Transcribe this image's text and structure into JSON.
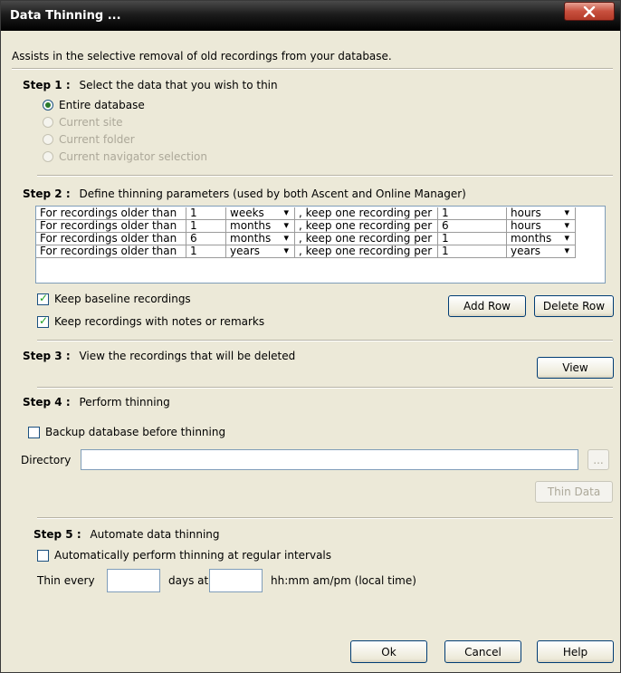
{
  "window": {
    "title": "Data Thinning ..."
  },
  "description": "Assists in the selective removal of old recordings from your database.",
  "step1": {
    "label": "Step 1 :",
    "text": "Select the data that you wish to thin",
    "options": [
      {
        "label": "Entire database",
        "selected": true,
        "enabled": true
      },
      {
        "label": "Current site",
        "selected": false,
        "enabled": false
      },
      {
        "label": "Current folder",
        "selected": false,
        "enabled": false
      },
      {
        "label": "Current navigator selection",
        "selected": false,
        "enabled": false
      }
    ]
  },
  "step2": {
    "label": "Step 2 :",
    "text": "Define thinning parameters (used by both Ascent and Online Manager)",
    "rows": [
      {
        "prefix": "For recordings older than",
        "age": "1",
        "age_unit": "weeks",
        "middle": ", keep one recording per",
        "keep": "1",
        "keep_unit": "hours"
      },
      {
        "prefix": "For recordings older than",
        "age": "1",
        "age_unit": "months",
        "middle": ", keep one recording per",
        "keep": "6",
        "keep_unit": "hours"
      },
      {
        "prefix": "For recordings older than",
        "age": "6",
        "age_unit": "months",
        "middle": ", keep one recording per",
        "keep": "1",
        "keep_unit": "months"
      },
      {
        "prefix": "For recordings older than",
        "age": "1",
        "age_unit": "years",
        "middle": ", keep one recording per",
        "keep": "1",
        "keep_unit": "years"
      }
    ],
    "keep_baseline": {
      "label": "Keep baseline recordings",
      "checked": true
    },
    "keep_notes": {
      "label": "Keep recordings with notes or remarks",
      "checked": true
    },
    "add_row": "Add Row",
    "delete_row": "Delete Row"
  },
  "step3": {
    "label": "Step 3 :",
    "text": "View the recordings that will be deleted",
    "view_button": "View"
  },
  "step4": {
    "label": "Step 4 :",
    "text": "Perform thinning",
    "backup": {
      "label": "Backup database before thinning",
      "checked": false
    },
    "directory_label": "Directory",
    "directory_value": "",
    "browse_label": "...",
    "thin_data_button": "Thin Data"
  },
  "step5": {
    "label": "Step 5 :",
    "text": "Automate data thinning",
    "auto": {
      "label": "Automatically perform thinning at regular intervals",
      "checked": false
    },
    "thin_every_label": "Thin every",
    "days_value": "",
    "days_at_label": "days at",
    "time_value": "",
    "time_hint": "hh:mm am/pm (local time)"
  },
  "footer": {
    "ok": "Ok",
    "cancel": "Cancel",
    "help": "Help"
  },
  "colors": {
    "titlebar": "#000000",
    "close_button": "#c8503e",
    "dialog_bg": "#ece9d8",
    "field_border": "#7f9db9"
  }
}
